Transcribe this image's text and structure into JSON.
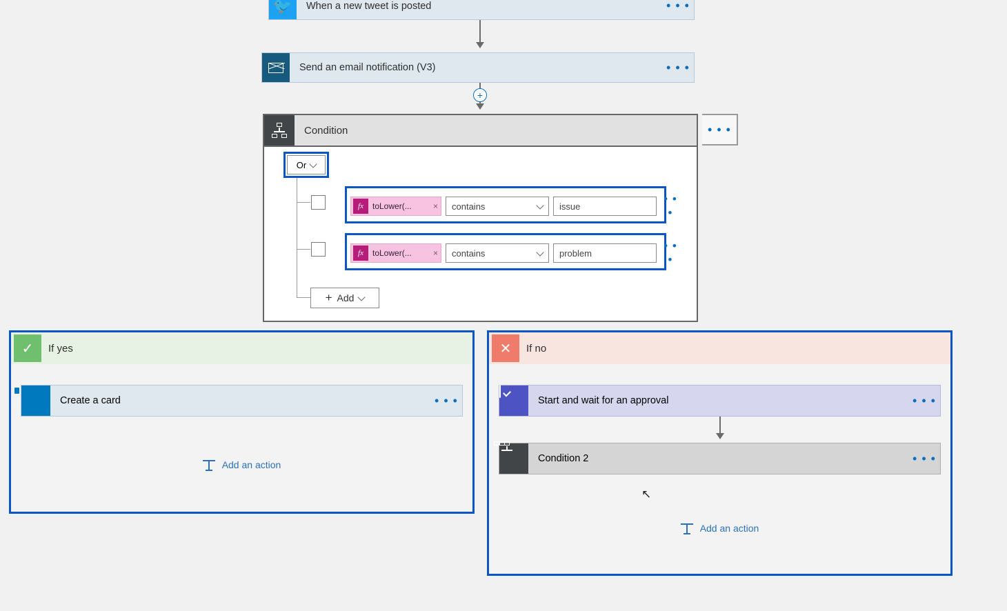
{
  "steps": {
    "trigger": {
      "label": "When a new tweet is posted"
    },
    "email": {
      "label": "Send an email notification (V3)"
    }
  },
  "condition": {
    "title": "Condition",
    "group_op": "Or",
    "add_label": "Add",
    "rows": [
      {
        "expr": "toLower(...",
        "operator": "contains",
        "value": "issue"
      },
      {
        "expr": "toLower(...",
        "operator": "contains",
        "value": "problem"
      }
    ]
  },
  "branches": {
    "yes": {
      "title": "If yes",
      "actions": [
        {
          "type": "trello",
          "label": "Create a card"
        }
      ],
      "add_label": "Add an action"
    },
    "no": {
      "title": "If no",
      "actions": [
        {
          "type": "approval",
          "label": "Start and wait for an approval"
        },
        {
          "type": "condition",
          "label": "Condition 2"
        }
      ],
      "add_label": "Add an action"
    }
  },
  "dots": "• • •",
  "fx": "fx"
}
